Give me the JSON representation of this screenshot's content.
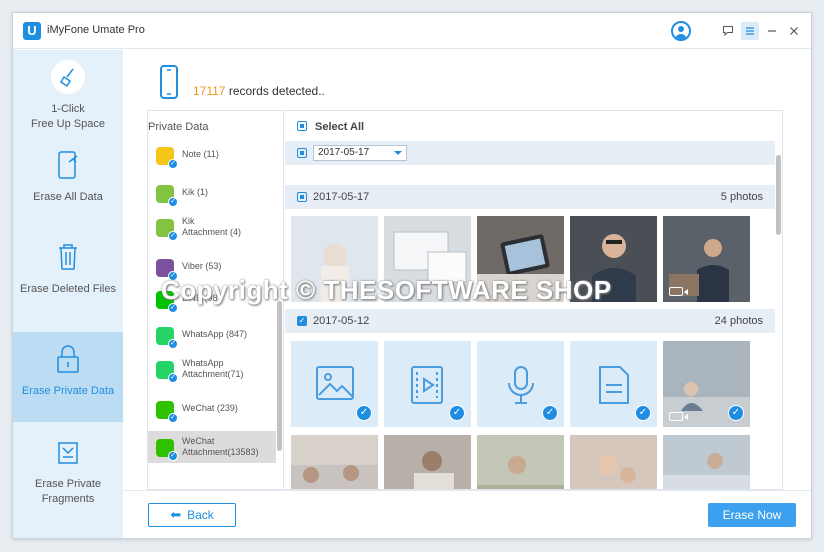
{
  "app": {
    "title": "iMyFone Umate Pro",
    "logo_letter": "U"
  },
  "sidebar": {
    "items": [
      {
        "label": "1-Click\nFree Up Space",
        "icon": "broom-icon"
      },
      {
        "label": "Erase All Data",
        "icon": "phone-erase-icon"
      },
      {
        "label": "Erase Deleted Files",
        "icon": "trash-icon"
      },
      {
        "label": "Erase Private Data",
        "icon": "lock-icon",
        "active": true
      },
      {
        "label": "Erase Private\nFragments",
        "icon": "fragments-icon"
      }
    ]
  },
  "header": {
    "count": "17117",
    "suffix": " records detected.."
  },
  "categories": {
    "heading": "Private Data",
    "items": [
      {
        "label": "Note (11)",
        "color": "#f5c518"
      },
      {
        "label": "Kik (1)",
        "color": "#82c341"
      },
      {
        "label": "Kik\nAttachment (4)",
        "color": "#82c341"
      },
      {
        "label": "Viber (53)",
        "color": "#7b519d"
      },
      {
        "label": "LINE (98)",
        "color": "#00c300"
      },
      {
        "label": "WhatsApp (847)",
        "color": "#25d366"
      },
      {
        "label": "WhatsApp\nAttachment(71)",
        "color": "#25d366"
      },
      {
        "label": "WeChat (239)",
        "color": "#2dc100"
      },
      {
        "label": "WeChat\nAttachment(13583)",
        "color": "#2dc100"
      }
    ]
  },
  "photos": {
    "select_all": "Select All",
    "filter_date": "2017-05-17",
    "groups": [
      {
        "date": "2017-05-17",
        "count": "5 photos"
      },
      {
        "date": "2017-05-12",
        "count": "24 photos"
      }
    ]
  },
  "watermark": "Copyright © THESOFTWARE SHOP",
  "footer": {
    "back": "Back",
    "erase": "Erase Now"
  },
  "colors": {
    "accent": "#1f8ee0",
    "highlight": "#f0991a"
  }
}
